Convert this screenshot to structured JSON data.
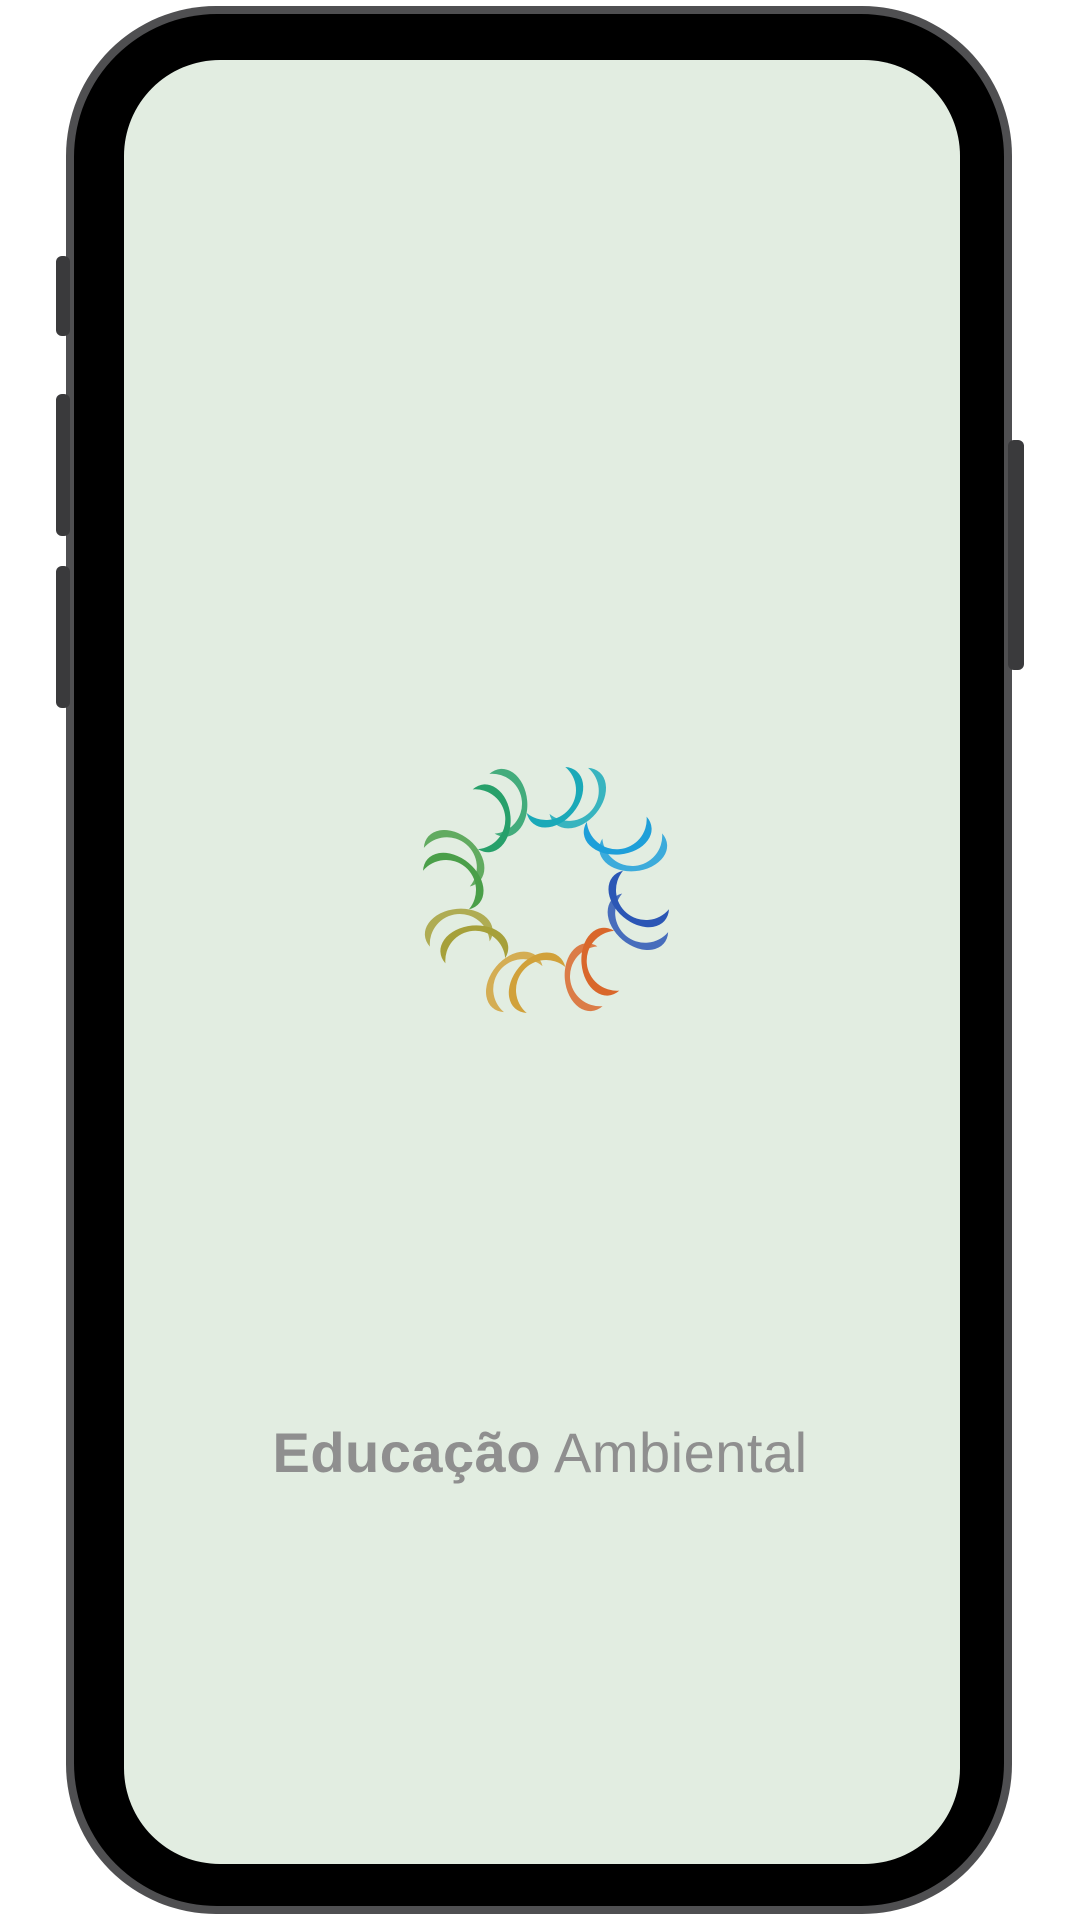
{
  "splash": {
    "app_name_bold": "Educação",
    "app_name_regular": "Ambiental",
    "logo_name": "pinwheel-logo-icon",
    "background_color": "#e2ede1",
    "text_color": "#8f8f8f"
  },
  "logo": {
    "segment_colors": [
      "#1aa9b8",
      "#1e9fd9",
      "#2b56b5",
      "#d9672b",
      "#d1a13a",
      "#a6a03a",
      "#4a9f49",
      "#27a06a"
    ]
  }
}
